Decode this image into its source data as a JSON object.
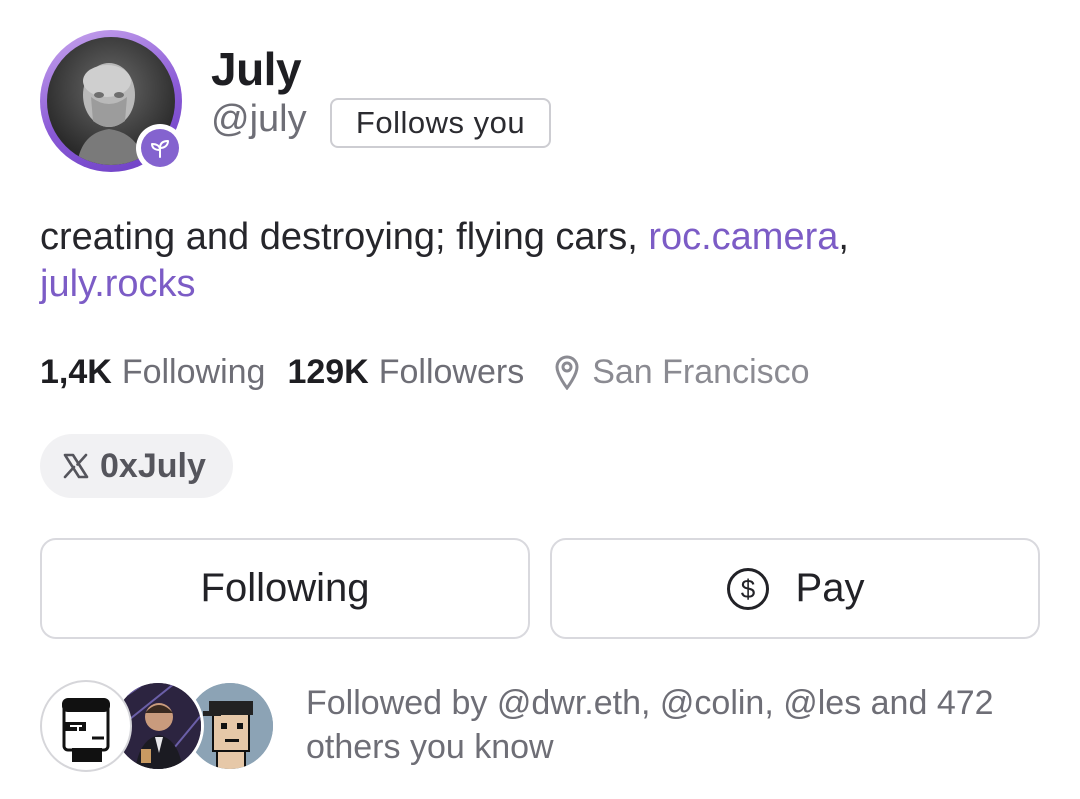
{
  "profile": {
    "display_name": "July",
    "username": "@july",
    "follows_you_badge": "Follows you",
    "avatar_icon": "profile-avatar-bust",
    "badge_icon": "plant-sprout-icon",
    "bio": {
      "text": "creating and destroying; flying cars, ",
      "link1": "roc.camera",
      "separator": ",",
      "link2": "july.rocks"
    }
  },
  "stats": {
    "following_count": "1,4K",
    "following_label": "Following",
    "followers_count": "129K",
    "followers_label": "Followers",
    "location_icon": "location-pin-icon",
    "location": "San Francisco"
  },
  "social": {
    "x_icon": "x-logo-icon",
    "x_handle": "0xJuly"
  },
  "actions": {
    "following_label": "Following",
    "pay_label": "Pay",
    "pay_icon": "dollar-circle-icon"
  },
  "mutuals": {
    "text_line1": "Followed by @dwr.eth, @colin, @les and 472",
    "text_line2": "others you know"
  },
  "colors": {
    "accent_purple": "#7c5cc6",
    "badge_purple": "#8463cf",
    "muted_text": "#6e6e76",
    "border": "#d9d9de"
  }
}
